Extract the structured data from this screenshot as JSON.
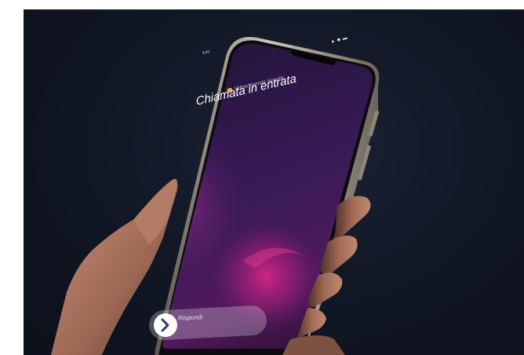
{
  "status_bar": {
    "time": "9:41",
    "icons": "▲ ◆ ▬"
  },
  "call": {
    "caller": "Videochiamata Security",
    "title": "Chiamata in entrata",
    "answer_label": "Rispondi",
    "icon": "chevron-right-icon"
  },
  "colors": {
    "background": "#0f1422",
    "screen_top": "#2a1645",
    "screen_glow": "#c8247a",
    "app_icon": "#f1b51f",
    "phone_frame": "#a89f93"
  }
}
